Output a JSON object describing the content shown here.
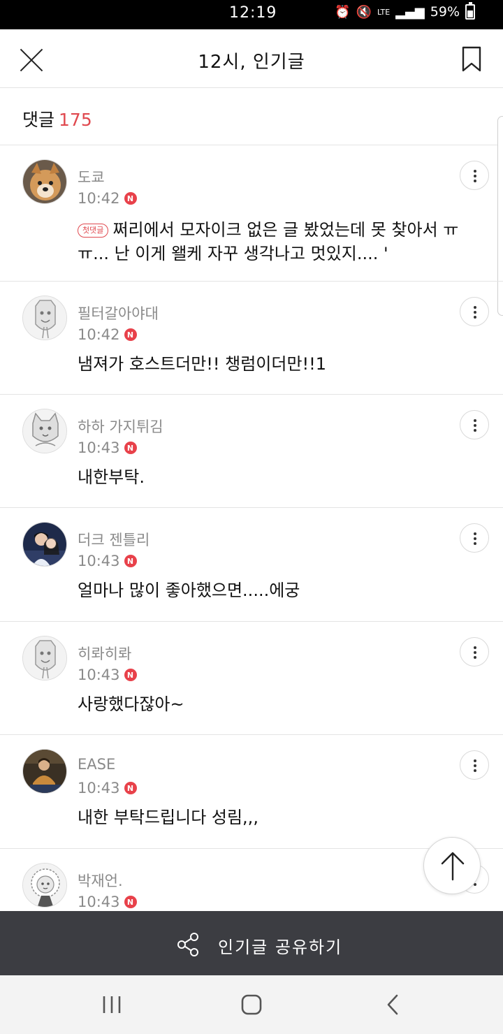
{
  "status_bar": {
    "time": "12:19",
    "network": "LTE",
    "battery": "59%"
  },
  "header": {
    "title": "12시, 인기글"
  },
  "comments_header": {
    "label": "댓글",
    "count": "175"
  },
  "comments": [
    {
      "author": "도쿄",
      "time": "10:42",
      "first_badge": "첫댓글",
      "text": "쩌리에서 모자이크 없은 글 봤었는데 못 찾아서 ㅠㅠ... 난 이게 왤케 자꾸 생각나고 멋있지.... '"
    },
    {
      "author": "필터갈아야대",
      "time": "10:42",
      "text": "냄져가 호스트더만!! 챙럼이더만!!1"
    },
    {
      "author": "하하 가지튀김",
      "time": "10:43",
      "text": "내한부탁."
    },
    {
      "author": "더크 젠틀리",
      "time": "10:43",
      "text": "얼마나 많이 좋아했으면.....에궁"
    },
    {
      "author": "히롸히롸",
      "time": "10:43",
      "text": "사랑했다잖아~"
    },
    {
      "author": "EASE",
      "time": "10:43",
      "text": "내한 부탁드립니다 성림,,,"
    },
    {
      "author": "박재언.",
      "time": "10:43",
      "text": ""
    }
  ],
  "new_badge": "N",
  "share_bar": {
    "label": "인기글 공유하기"
  },
  "colors": {
    "accent": "#e0494f",
    "share_bar_bg": "#3c3d42"
  },
  "icons": [
    "close-icon",
    "bookmark-icon",
    "more-icon",
    "arrow-up-icon",
    "share-icon",
    "recent-apps-icon",
    "home-icon",
    "back-icon"
  ]
}
